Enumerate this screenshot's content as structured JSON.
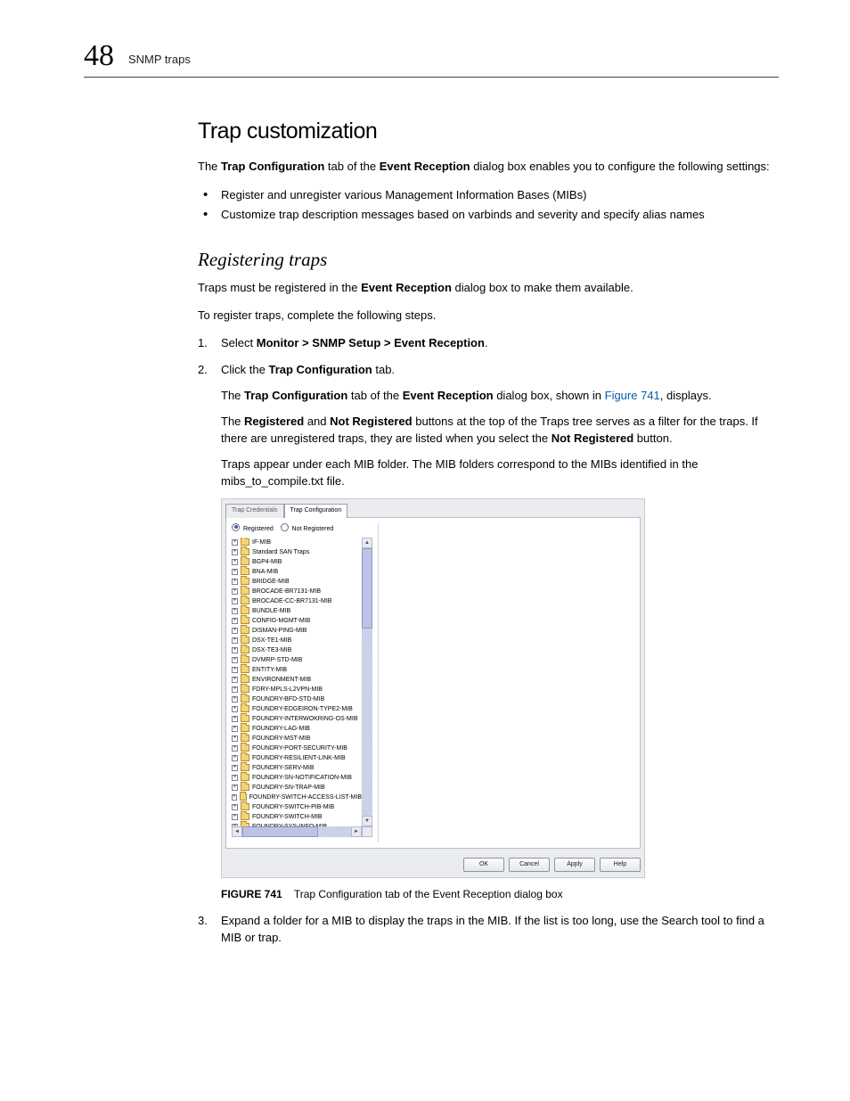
{
  "header": {
    "chapter_number": "48",
    "running_title": "SNMP traps"
  },
  "section": {
    "h1": "Trap customization",
    "intro_pre": "The ",
    "intro_bold1": "Trap Configuration",
    "intro_mid1": " tab of the ",
    "intro_bold2": "Event Reception",
    "intro_post": " dialog box enables you to configure the following settings:",
    "bullets": [
      "Register and unregister various Management Information Bases (MIBs)",
      "Customize trap description messages based on varbinds and severity and specify alias names"
    ],
    "h2": "Registering traps",
    "p2_pre": "Traps must be registered in the ",
    "p2_bold": "Event Reception",
    "p2_post": " dialog box to make them available.",
    "p3": "To register traps, complete the following steps.",
    "step1_pre": "Select ",
    "step1_bold": "Monitor > SNMP Setup > Event Reception",
    "step1_post": ".",
    "step2_pre": "Click the ",
    "step2_bold": "Trap Configuration",
    "step2_post": " tab.",
    "step2_p1_pre": "The ",
    "step2_p1_b1": "Trap Configuration",
    "step2_p1_mid": " tab of the ",
    "step2_p1_b2": "Event Reception",
    "step2_p1_mid2": " dialog box, shown in ",
    "step2_p1_link": "Figure 741",
    "step2_p1_post": ", displays.",
    "step2_p2_pre": "The ",
    "step2_p2_b1": "Registered",
    "step2_p2_mid1": " and ",
    "step2_p2_b2": "Not Registered",
    "step2_p2_mid2": " buttons at the top of the Traps tree serves as a filter for the traps. If there are unregistered traps, they are listed when you select the ",
    "step2_p2_b3": "Not Registered",
    "step2_p2_post": " button.",
    "step2_p3": "Traps appear under each MIB folder. The MIB folders correspond to the MIBs identified in the mibs_to_compile.txt file.",
    "step3": "Expand a folder for a MIB to display the traps in the MIB. If the list is too long, use the Search tool to find a MIB or trap."
  },
  "figure": {
    "label": "FIGURE 741",
    "caption": "Trap Configuration tab of the Event Reception dialog box"
  },
  "dialog": {
    "tabs": {
      "t1": "Trap Credentials",
      "t2": "Trap Configuration"
    },
    "filter": {
      "registered": "Registered",
      "not_registered": "Not Registered"
    },
    "tree": [
      "IF-MIB",
      "Standard SAN Traps",
      "BGP4-MIB",
      "BNA-MIB",
      "BRIDGE-MIB",
      "BROCADE-BR7131-MIB",
      "BROCADE-CC-BR7131-MIB",
      "BUNDLE-MIB",
      "CONFIG-MGMT-MIB",
      "DISMAN-PING-MIB",
      "DSX-TE1-MIB",
      "DSX-TE3-MIB",
      "DVMRP-STD-MIB",
      "ENTITY-MIB",
      "ENVIRONMENT-MIB",
      "FDRY-MPLS-L2VPN-MIB",
      "FOUNDRY-BFD-STD-MIB",
      "FOUNDRY-EDGEIRON-TYPE2-MIB",
      "FOUNDRY-INTERWOKRING-OS-MIB",
      "FOUNDRY-LAG-MIB",
      "FOUNDRY-MST-MIB",
      "FOUNDRY-PORT-SECURITY-MIB",
      "FOUNDRY-RESILIENT-LINK-MIB",
      "FOUNDRY-SERV-MIB",
      "FOUNDRY-SN-NOTIFICATION-MIB",
      "FOUNDRY-SN-TRAP-MIB",
      "FOUNDRY-SWITCH-ACCESS-LIST-MIB",
      "FOUNDRY-SWITCH-PIB-MIB",
      "FOUNDRY-SWITCH-MIB",
      "FOUNDRY-SYS-INFO-MIB"
    ],
    "buttons": {
      "ok": "OK",
      "cancel": "Cancel",
      "apply": "Apply",
      "help": "Help"
    }
  }
}
